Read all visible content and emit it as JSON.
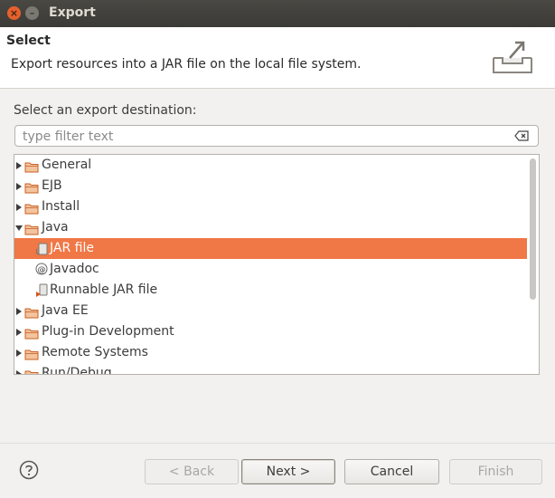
{
  "window": {
    "title": "Export",
    "close_glyph": "×",
    "minimize_glyph": "–"
  },
  "header": {
    "title": "Select",
    "description": "Export resources into a JAR file on the local file system.",
    "icon": "export-wizard-icon"
  },
  "destination": {
    "label": "Select an export destination:",
    "filter_placeholder": "type filter text",
    "filter_value": ""
  },
  "tree": {
    "selected_color": "#f07746",
    "items": [
      {
        "label": "General",
        "expanded": false
      },
      {
        "label": "EJB",
        "expanded": false
      },
      {
        "label": "Install",
        "expanded": false
      },
      {
        "label": "Java",
        "expanded": true
      },
      {
        "label": "JAR file",
        "child": true,
        "selected": true,
        "icon": "jar-file-icon"
      },
      {
        "label": "Javadoc",
        "child": true,
        "icon": "javadoc-icon"
      },
      {
        "label": "Runnable JAR file",
        "child": true,
        "icon": "runnable-jar-icon"
      },
      {
        "label": "Java EE",
        "expanded": false
      },
      {
        "label": "Plug-in Development",
        "expanded": false
      },
      {
        "label": "Remote Systems",
        "expanded": false
      },
      {
        "label": "Run/Debug",
        "expanded": false
      }
    ]
  },
  "buttons": {
    "back": "< Back",
    "next": "Next >",
    "cancel": "Cancel",
    "finish": "Finish"
  },
  "colors": {
    "accent": "#f07746",
    "titlebar": "#3b3a36",
    "folder": "#e57c3b"
  }
}
